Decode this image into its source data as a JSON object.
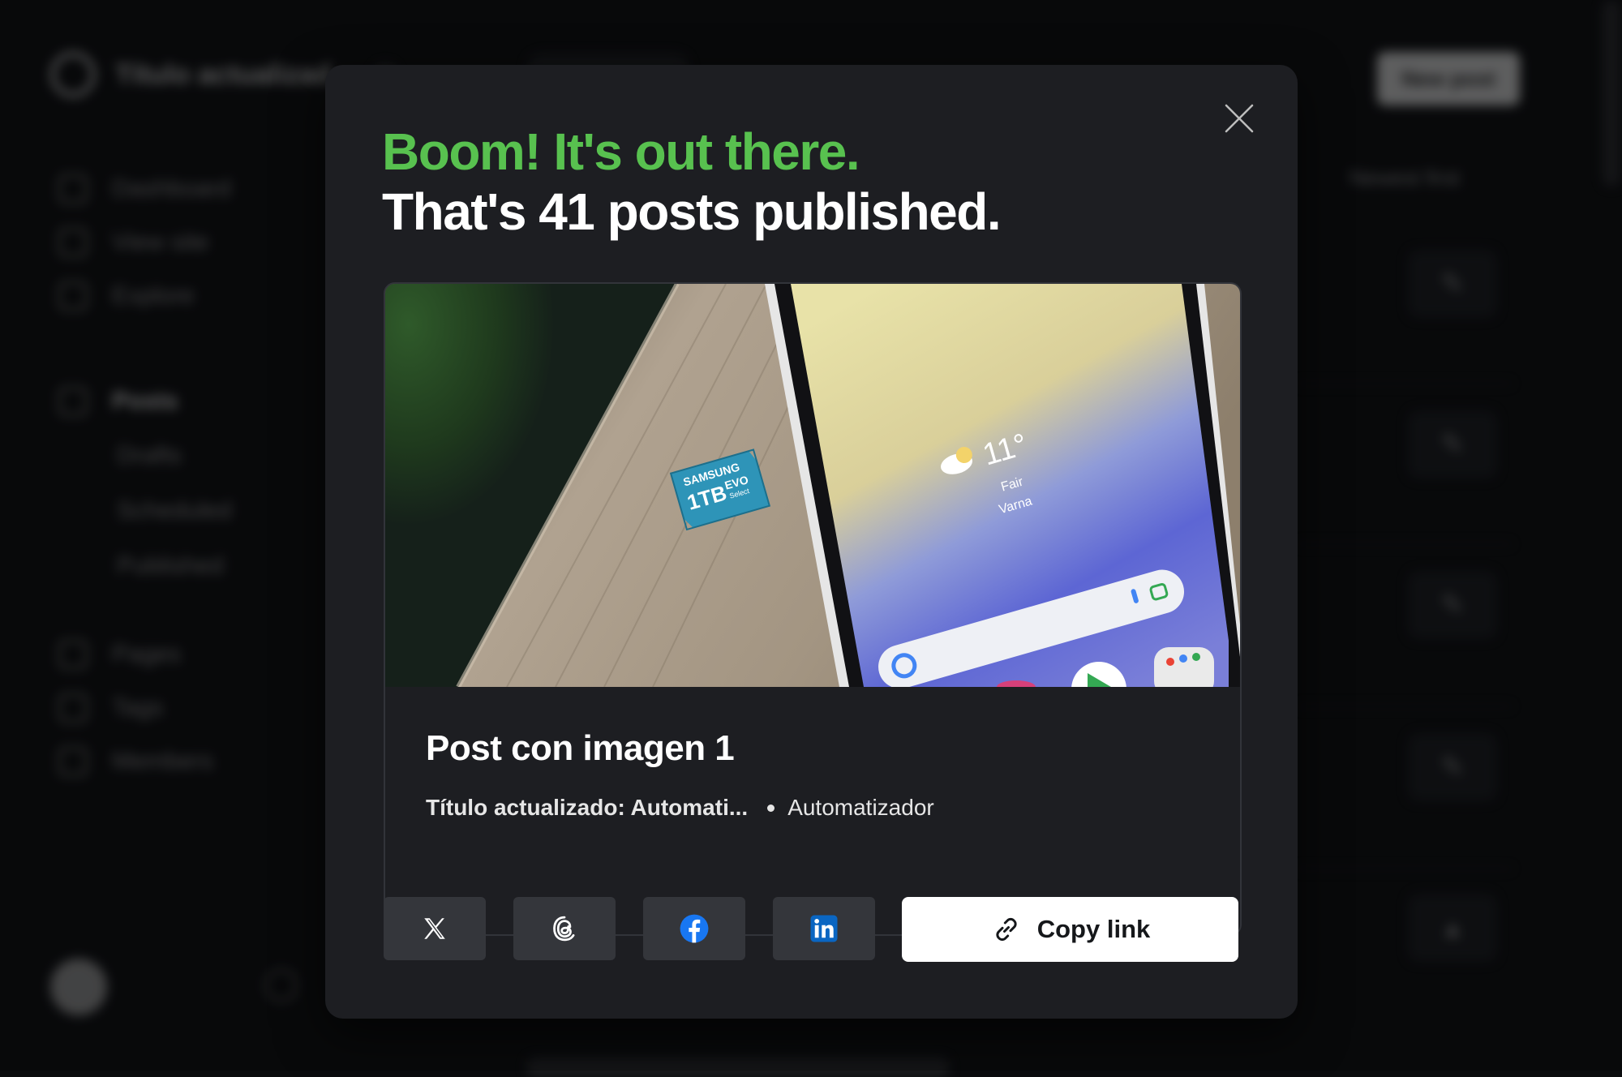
{
  "background": {
    "site_title": "Título actualizad",
    "new_post_label": "New post",
    "sort_label": "Newest first",
    "nav": [
      {
        "label": "Dashboard",
        "icon": "dashboard-icon"
      },
      {
        "label": "View site",
        "icon": "view-site-icon"
      },
      {
        "label": "Explore",
        "icon": "explore-icon"
      }
    ],
    "posts_nav": {
      "label": "Posts",
      "icon": "posts-icon",
      "sub_items": [
        "Drafts",
        "Scheduled",
        "Published"
      ]
    },
    "nav_bottom": [
      {
        "label": "Pages",
        "icon": "pages-icon"
      },
      {
        "label": "Tags",
        "icon": "tags-icon"
      },
      {
        "label": "Members",
        "icon": "members-icon"
      }
    ]
  },
  "modal": {
    "headline_line1": "Boom! It's out there.",
    "headline_line2": "That's 41 posts published.",
    "colors": {
      "accent_green": "#58c14f",
      "modal_bg": "#1d1e22",
      "button_bg": "#34363b"
    },
    "post": {
      "title": "Post con imagen 1",
      "excerpt": "Título actualizado: Automati...",
      "author": "Automatizador",
      "image": {
        "icon": "feature-image",
        "weather_temp": "11°",
        "weather_condition": "Fair",
        "weather_location": "Varna",
        "card_brand": "SAMSUNG",
        "card_capacity": "1TB",
        "card_model": "EVO",
        "card_sub": "Select"
      }
    },
    "share": {
      "buttons": [
        {
          "icon": "x-icon",
          "label": "X"
        },
        {
          "icon": "threads-icon",
          "label": "Threads"
        },
        {
          "icon": "facebook-icon",
          "label": "Facebook"
        },
        {
          "icon": "linkedin-icon",
          "label": "LinkedIn"
        }
      ],
      "copy_link_label": "Copy link",
      "copy_link_icon": "link-icon"
    },
    "close_icon": "close-icon"
  }
}
